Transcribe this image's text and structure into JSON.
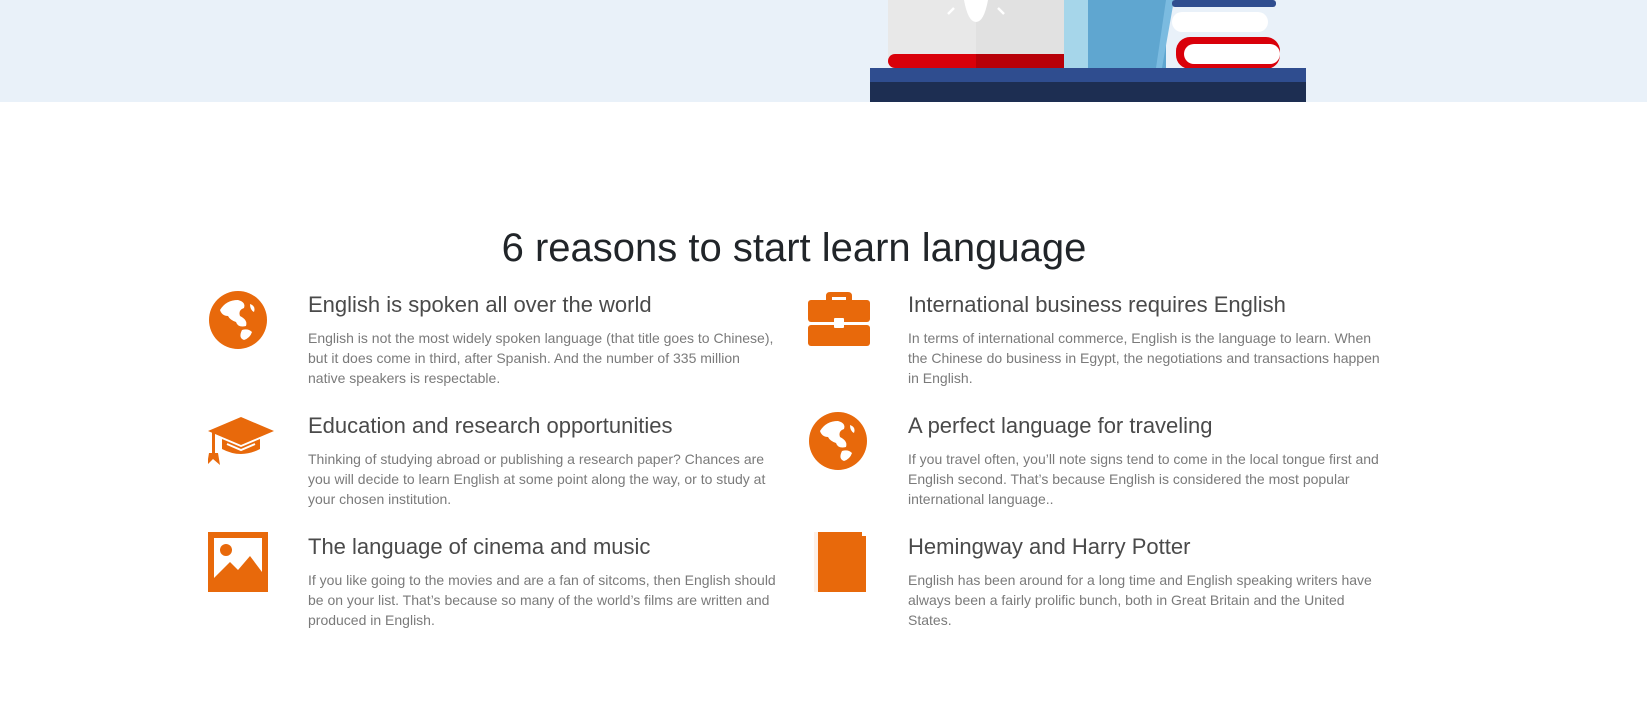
{
  "section": {
    "title": "6 reasons to start learn language"
  },
  "features": [
    {
      "icon": "globe-icon",
      "title": "English is spoken all over the world",
      "text": "English is not the most widely spoken language (that title goes to Chinese), but it does come in third, after Spanish. And the number of 335 million native speakers is respectable."
    },
    {
      "icon": "briefcase-icon",
      "title": "International business requires English",
      "text": "In terms of international commerce, English is the language to learn. When the Chinese do business in Egypt, the negotiations and transactions happen in English."
    },
    {
      "icon": "graduation-cap-icon",
      "title": "Education and research opportunities",
      "text": "Thinking of studying abroad or publishing a research paper? Chances are you will decide to learn English at some point along the way, or to study at your chosen institution."
    },
    {
      "icon": "globe-icon",
      "title": "A perfect language for traveling",
      "text": "If you travel often, you’ll note signs tend to come in the local tongue first and English second. That’s because English is considered the most popular international language.."
    },
    {
      "icon": "image-icon",
      "title": "The language of cinema and music",
      "text": "If you like going to the movies and are a fan of sitcoms, then English should be on your list. That’s because so many of the world’s films are written and produced in English."
    },
    {
      "icon": "book-icon",
      "title": "Hemingway and Harry Potter",
      "text": "English has been around for a long time and English speaking writers have always been a fairly prolific bunch, both in Great Britain and the United States."
    }
  ],
  "colors": {
    "accent": "#e8690b",
    "hero_bg": "#e9f1f9",
    "title": "#212529",
    "heading": "#4a4a4a",
    "body_text": "#7a7a7a"
  }
}
